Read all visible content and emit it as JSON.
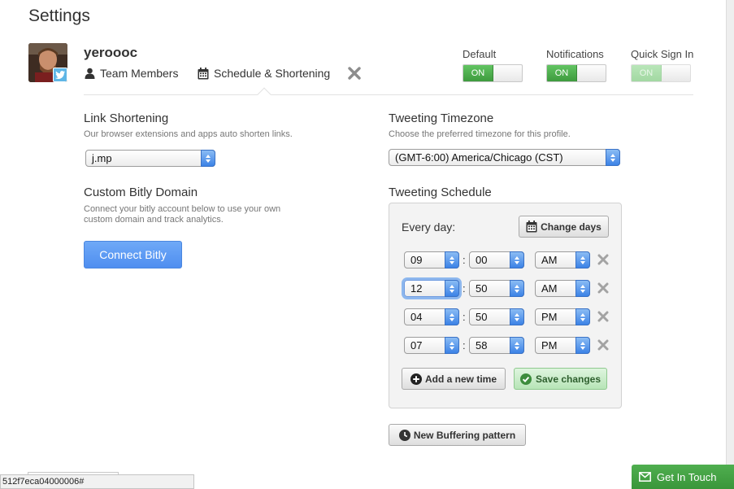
{
  "page": {
    "title": "Settings"
  },
  "profile": {
    "username": "yeroooc",
    "tabs": [
      {
        "label": "Team Members",
        "icon": "person-icon"
      },
      {
        "label": "Schedule & Shortening",
        "icon": "calendar-icon"
      }
    ],
    "close_icon": "close-icon"
  },
  "toggles": [
    {
      "label": "Default",
      "state": "ON"
    },
    {
      "label": "Notifications",
      "state": "ON"
    },
    {
      "label": "Quick Sign In",
      "state": "ON"
    }
  ],
  "link_shortening": {
    "title": "Link Shortening",
    "desc": "Our browser extensions and apps auto shorten links.",
    "value": "j.mp"
  },
  "custom_domain": {
    "title": "Custom Bitly Domain",
    "desc_line1": "Connect your bitly account below to use your own",
    "desc_line2": "custom domain and track analytics.",
    "button": "Connect Bitly"
  },
  "timezone": {
    "title": "Tweeting Timezone",
    "desc": "Choose the preferred timezone for this profile.",
    "value": "(GMT-6:00) America/Chicago (CST)"
  },
  "schedule": {
    "title": "Tweeting Schedule",
    "every_day": "Every day:",
    "change_days": "Change days",
    "rows": [
      {
        "hour": "09",
        "minute": "00",
        "ampm": "AM"
      },
      {
        "hour": "12",
        "minute": "50",
        "ampm": "AM"
      },
      {
        "hour": "04",
        "minute": "50",
        "ampm": "PM"
      },
      {
        "hour": "07",
        "minute": "58",
        "ampm": "PM"
      }
    ],
    "separator": ":",
    "add_time": "Add a new time",
    "save": "Save changes"
  },
  "new_pattern": "New Buffering pattern",
  "status_bar": "512f7eca04000006#",
  "get_in_touch": "Get In Touch",
  "colors": {
    "toggle_on": "#4cae4c",
    "select_arrow": "#4a8ff0",
    "connect_button": "#5b98f2",
    "get_in_touch": "#43a243"
  }
}
